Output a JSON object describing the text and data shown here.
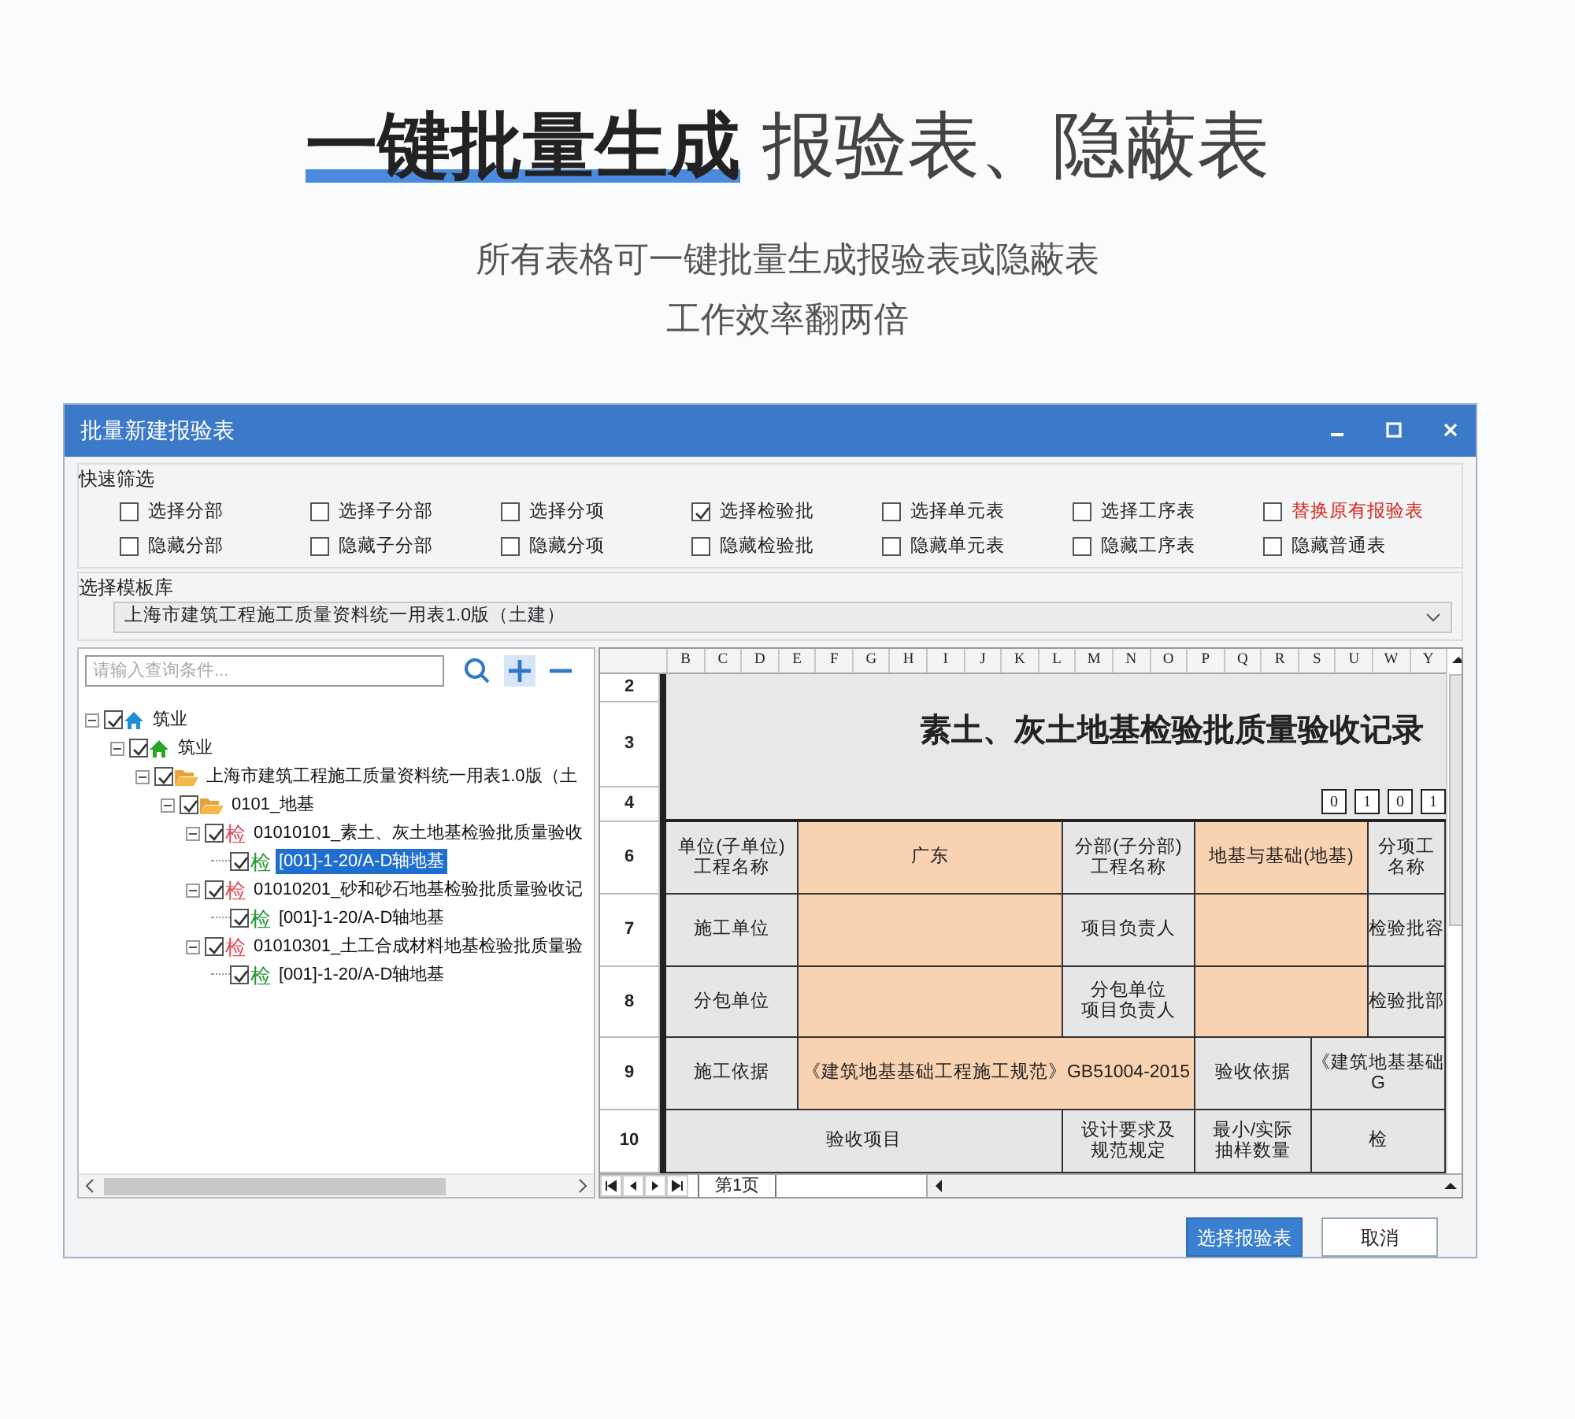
{
  "headline": {
    "bold": "一键批量生成",
    "rest": "报验表、隐蔽表"
  },
  "subtitle_lines": [
    "所有表格可一键批量生成报验表或隐蔽表",
    "工作效率翻两倍"
  ],
  "window": {
    "title": "批量新建报验表"
  },
  "quick_filter": {
    "label": "快速筛选",
    "options": [
      {
        "label": "选择分部",
        "checked": false,
        "warning": false
      },
      {
        "label": "选择子分部",
        "checked": false,
        "warning": false
      },
      {
        "label": "选择分项",
        "checked": false,
        "warning": false
      },
      {
        "label": "选择检验批",
        "checked": true,
        "warning": false
      },
      {
        "label": "选择单元表",
        "checked": false,
        "warning": false
      },
      {
        "label": "选择工序表",
        "checked": false,
        "warning": false
      },
      {
        "label": "替换原有报验表",
        "checked": false,
        "warning": true
      },
      {
        "label": "隐藏分部",
        "checked": false,
        "warning": false
      },
      {
        "label": "隐藏子分部",
        "checked": false,
        "warning": false
      },
      {
        "label": "隐藏分项",
        "checked": false,
        "warning": false
      },
      {
        "label": "隐藏检验批",
        "checked": false,
        "warning": false
      },
      {
        "label": "隐藏单元表",
        "checked": false,
        "warning": false
      },
      {
        "label": "隐藏工序表",
        "checked": false,
        "warning": false
      },
      {
        "label": "隐藏普通表",
        "checked": false,
        "warning": false
      }
    ]
  },
  "template": {
    "label": "选择模板库",
    "value": "上海市建筑工程施工质量资料统一用表1.0版（土建）"
  },
  "search": {
    "placeholder": "请输入查询条件..."
  },
  "tree": [
    {
      "label": "筑业",
      "checked": true,
      "expanded": true,
      "selected": false,
      "icon": {
        "kind": "home",
        "color": "#1e8fd6"
      },
      "children": [
        {
          "label": "筑业",
          "checked": true,
          "expanded": true,
          "selected": false,
          "icon": {
            "kind": "home",
            "color": "#2aa52a"
          },
          "children": [
            {
              "label": "上海市建筑工程施工质量资料统一用表1.0版（土",
              "checked": true,
              "expanded": true,
              "selected": false,
              "icon": {
                "kind": "folder"
              },
              "children": [
                {
                  "label": "0101_地基",
                  "checked": true,
                  "expanded": true,
                  "selected": false,
                  "icon": {
                    "kind": "folder"
                  },
                  "children": [
                    {
                      "label": "01010101_素土、灰土地基检验批质量验收",
                      "checked": true,
                      "expanded": true,
                      "selected": false,
                      "icon": {
                        "kind": "badge",
                        "text": "检",
                        "color": "#e0505a"
                      },
                      "children": [
                        {
                          "label": "[001]-1-20/A-D轴地基",
                          "checked": true,
                          "selected": true,
                          "icon": {
                            "kind": "badge",
                            "text": "检",
                            "color": "#2a9a3a"
                          }
                        }
                      ]
                    },
                    {
                      "label": "01010201_砂和砂石地基检验批质量验收记",
                      "checked": true,
                      "expanded": true,
                      "selected": false,
                      "icon": {
                        "kind": "badge",
                        "text": "检",
                        "color": "#e0505a"
                      },
                      "children": [
                        {
                          "label": "[001]-1-20/A-D轴地基",
                          "checked": true,
                          "selected": false,
                          "icon": {
                            "kind": "badge",
                            "text": "检",
                            "color": "#2a9a3a"
                          }
                        }
                      ]
                    },
                    {
                      "label": "01010301_土工合成材料地基检验批质量验",
                      "checked": true,
                      "expanded": true,
                      "selected": false,
                      "icon": {
                        "kind": "badge",
                        "text": "检",
                        "color": "#e0505a"
                      },
                      "children": [
                        {
                          "label": "[001]-1-20/A-D轴地基",
                          "checked": true,
                          "selected": false,
                          "icon": {
                            "kind": "badge",
                            "text": "检",
                            "color": "#2a9a3a"
                          }
                        }
                      ]
                    }
                  ]
                }
              ]
            }
          ]
        }
      ]
    }
  ],
  "sheet": {
    "column_headers": [
      "B",
      "C",
      "D",
      "E",
      "F",
      "G",
      "H",
      "I",
      "J",
      "K",
      "L",
      "M",
      "N",
      "O",
      "P",
      "Q",
      "R",
      "S",
      "U",
      "W",
      "Y"
    ],
    "title_rows": [
      "2",
      "3",
      "4"
    ],
    "title": "素土、灰土地基检验批质量验收记录",
    "code_digits": [
      "0",
      "1",
      "0",
      "1"
    ],
    "rows": [
      {
        "header": "6",
        "kind": "a",
        "cells": [
          {
            "kind": "label",
            "lines": [
              "单位(子单位)",
              "工程名称"
            ]
          },
          {
            "kind": "input",
            "lines": [
              "广东"
            ]
          },
          {
            "kind": "label",
            "lines": [
              "分部(子分部)",
              "工程名称"
            ]
          },
          {
            "kind": "input",
            "lines": [
              "地基与基础(地基)"
            ]
          },
          {
            "kind": "label",
            "lines": [
              "分项工",
              "名称"
            ]
          }
        ]
      },
      {
        "header": "7",
        "kind": "a",
        "cells": [
          {
            "kind": "label",
            "lines": [
              "施工单位"
            ]
          },
          {
            "kind": "input"
          },
          {
            "kind": "label",
            "lines": [
              "项目负责人"
            ]
          },
          {
            "kind": "input"
          },
          {
            "kind": "label",
            "lines": [
              "检验批容"
            ]
          }
        ]
      },
      {
        "header": "8",
        "kind": "a",
        "cells": [
          {
            "kind": "label",
            "lines": [
              "分包单位"
            ]
          },
          {
            "kind": "input"
          },
          {
            "kind": "label",
            "lines": [
              "分包单位",
              "项目负责人"
            ]
          },
          {
            "kind": "input"
          },
          {
            "kind": "label",
            "lines": [
              "检验批部"
            ]
          }
        ]
      },
      {
        "header": "9",
        "kind": "b",
        "cells": [
          {
            "kind": "label",
            "lines": [
              "施工依据"
            ]
          },
          {
            "kind": "input",
            "lines": [
              "《建筑地基基础工程施工规范》GB51004-2015"
            ]
          },
          {
            "kind": "label",
            "lines": [
              "验收依据"
            ]
          },
          {
            "kind": "label",
            "lines": [
              "《建筑地基基础",
              "G"
            ]
          }
        ]
      },
      {
        "header": "10",
        "kind": "c",
        "cells": [
          {
            "kind": "label",
            "lines": [
              "验收项目"
            ]
          },
          {
            "kind": "label",
            "lines": [
              "设计要求及",
              "规范规定"
            ]
          },
          {
            "kind": "label",
            "lines": [
              "最小/实际",
              "抽样数量"
            ]
          },
          {
            "kind": "label",
            "lines": [
              "检"
            ]
          }
        ]
      }
    ]
  },
  "sheet_tabs": [
    {
      "label": "第1页",
      "selected": true
    }
  ],
  "buttons": [
    {
      "label": "选择报验表",
      "primary": true
    },
    {
      "label": "取消",
      "primary": false
    }
  ]
}
